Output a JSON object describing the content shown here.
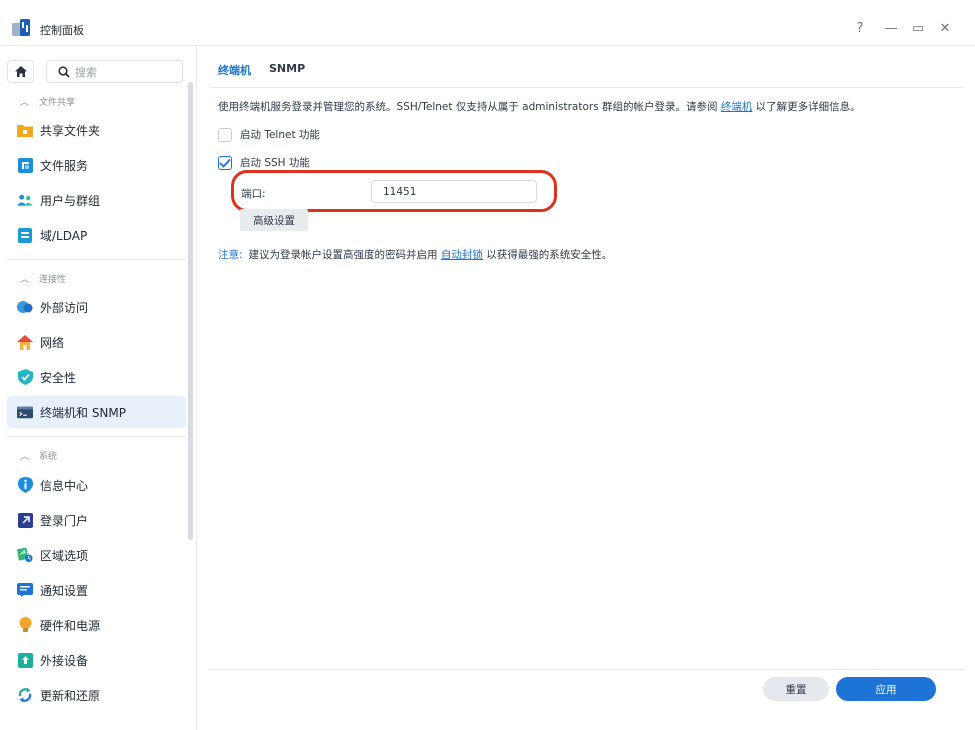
{
  "window": {
    "title": "控制面板",
    "help_label": "?",
    "minimize_label": "—",
    "maximize_label": "▭",
    "close_label": "✕"
  },
  "sidebar": {
    "search_placeholder": "搜索",
    "groups": [
      {
        "header": "文件共享",
        "items": [
          "共享文件夹",
          "文件服务",
          "用户与群组",
          "域/LDAP"
        ]
      },
      {
        "header": "连接性",
        "items": [
          "外部访问",
          "网络",
          "安全性",
          "终端机和 SNMP"
        ]
      },
      {
        "header": "系统",
        "items": [
          "信息中心",
          "登录门户",
          "区域选项",
          "通知设置",
          "硬件和电源",
          "外接设备",
          "更新和还原"
        ]
      }
    ],
    "active_item": "终端机和 SNMP"
  },
  "main": {
    "tabs": [
      {
        "label": "终端机",
        "active": true
      },
      {
        "label": "SNMP",
        "active": false
      }
    ],
    "description": {
      "text_before": "使用终端机服务登录并管理您的系统。SSH/Telnet 仅支持从属于 administrators 群组的帐户登录。请参阅 ",
      "link": "终端机",
      "text_after": " 以了解更多详细信息。"
    },
    "telnet": {
      "label": "启动 Telnet 功能",
      "checked": false
    },
    "ssh": {
      "label": "启动 SSH 功能",
      "checked": true
    },
    "port": {
      "label": "端口:",
      "value": "11451"
    },
    "advanced_label": "高级设置",
    "note": {
      "prefix": "注意:",
      "text_before": "建议为登录帐户设置高强度的密码并启用 ",
      "link": "自动封锁",
      "text_after": " 以获得最强的系统安全性。"
    },
    "reset_label": "重置",
    "apply_label": "应用"
  },
  "colors": {
    "accent": "#1d74d6",
    "highlight": "#e0301e",
    "active_bg": "#e8f1fb"
  }
}
